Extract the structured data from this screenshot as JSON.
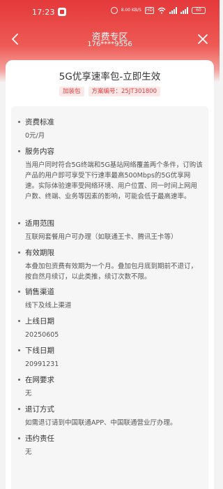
{
  "status_bar": {
    "time": "17:23",
    "speed": "8.00 KB/S",
    "hd": "HD",
    "battery": "60"
  },
  "nav": {
    "title": "资费专区",
    "subtitle": "176****9556"
  },
  "product": {
    "title": "5G优享速率包-立即生效",
    "tag_type": "加装包",
    "tag_plan": "方案编号：25JT301800"
  },
  "sections": [
    {
      "label": "资费标准",
      "value": "0元/月"
    },
    {
      "label": "服务内容",
      "value": "当用户同时符合5G终端和5G基站网络覆盖两个条件，订购该产品的用户即可享受下行速率最高500Mbps的5G优享网速。实际体验速率受网络环境、用户位置、同一时间上网用户数、终端、业务等因素的影响，可能会低于最高速率。"
    },
    {
      "label": "适用范围",
      "value": "互联网套餐用户可办理（如联通王卡、腾讯王卡等）"
    },
    {
      "label": "有效期限",
      "value": "本叠加包资费有效期为一个月。叠加包月底到期前不退订，按自然月续订，以此类推，续订次数不限。"
    },
    {
      "label": "销售渠道",
      "value": "线下及线上渠道"
    },
    {
      "label": "上线日期",
      "value": "20250605"
    },
    {
      "label": "下线日期",
      "value": "20991231"
    },
    {
      "label": "在网要求",
      "value": "无"
    },
    {
      "label": "退订方式",
      "value": "如需退订请到中国联通APP、中国联通营业厅办理。"
    },
    {
      "label": "违约责任",
      "value": "无"
    }
  ],
  "colors": {
    "accent": "#e4383a",
    "tag_bg": "#fde8e8"
  }
}
